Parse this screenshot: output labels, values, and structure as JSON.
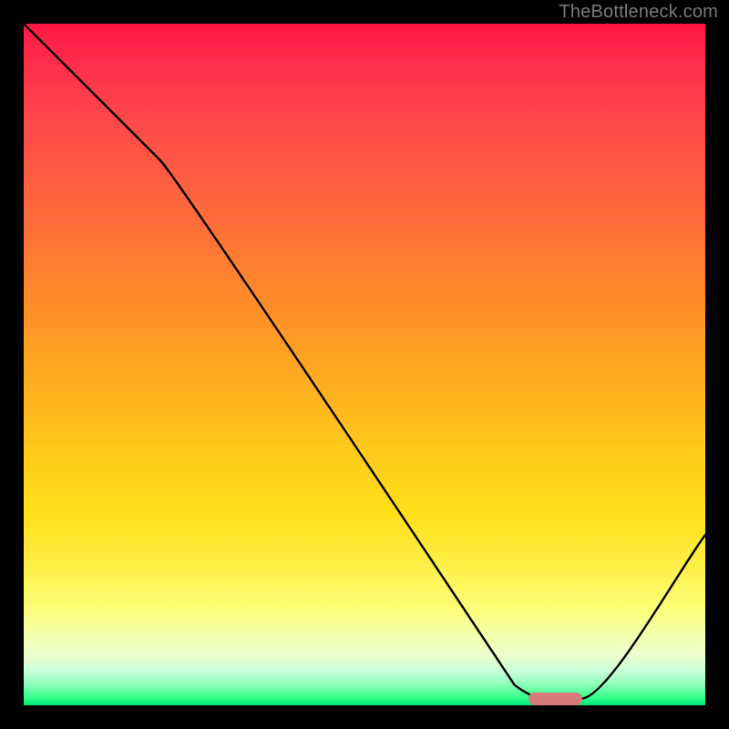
{
  "attribution": "TheBottleneck.com",
  "chart_data": {
    "type": "line",
    "title": "",
    "xlabel": "",
    "ylabel": "",
    "xlim": [
      0,
      100
    ],
    "ylim": [
      0,
      100
    ],
    "x": [
      0,
      20,
      72,
      76,
      82,
      100
    ],
    "values": [
      100,
      80,
      3,
      1,
      1,
      25
    ],
    "marker": {
      "x_start": 74,
      "x_end": 82,
      "y": 1
    },
    "gradient_stops": [
      {
        "pos": 0,
        "color": "#ff1744"
      },
      {
        "pos": 50,
        "color": "#ffc400"
      },
      {
        "pos": 90,
        "color": "#fff176"
      },
      {
        "pos": 100,
        "color": "#00e676"
      }
    ]
  }
}
